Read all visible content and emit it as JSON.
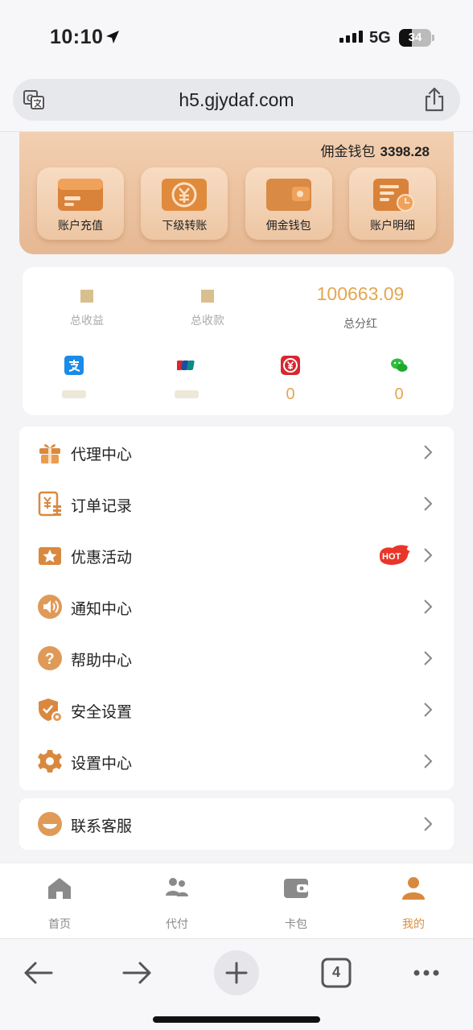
{
  "status_bar": {
    "time": "10:10",
    "network": "5G",
    "battery": "34"
  },
  "browser": {
    "url": "h5.gjydaf.com",
    "tab_count": "4"
  },
  "wallet": {
    "label": "佣金钱包",
    "amount": "3398.28",
    "actions": [
      {
        "label": "账户充值",
        "icon": "card-icon"
      },
      {
        "label": "下级转账",
        "icon": "yuan-exchange-icon"
      },
      {
        "label": "佣金钱包",
        "icon": "wallet-icon"
      },
      {
        "label": "账户明细",
        "icon": "statement-icon"
      }
    ]
  },
  "stats": {
    "total_income_label": "总收益",
    "total_receipts_label": "总收款",
    "total_dividend_label": "总分红",
    "total_dividend_value": "100663.09",
    "channels": [
      {
        "icon": "alipay-icon",
        "value": ""
      },
      {
        "icon": "unionpay-icon",
        "value": ""
      },
      {
        "icon": "digital-yuan-icon",
        "value": "0"
      },
      {
        "icon": "wechat-icon",
        "value": "0"
      }
    ]
  },
  "menu": [
    {
      "label": "代理中心",
      "icon": "gift-icon"
    },
    {
      "label": "订单记录",
      "icon": "order-icon"
    },
    {
      "label": "优惠活动",
      "icon": "star-icon",
      "badge": "HOT"
    },
    {
      "label": "通知中心",
      "icon": "speaker-icon"
    },
    {
      "label": "帮助中心",
      "icon": "question-icon"
    },
    {
      "label": "安全设置",
      "icon": "shield-icon"
    },
    {
      "label": "设置中心",
      "icon": "gear-icon"
    }
  ],
  "contact": {
    "label": "联系客服",
    "icon": "smile-icon"
  },
  "tabbar": {
    "items": [
      {
        "label": "首页",
        "icon": "home-icon"
      },
      {
        "label": "代付",
        "icon": "users-icon"
      },
      {
        "label": "卡包",
        "icon": "wallet-icon"
      },
      {
        "label": "我的",
        "icon": "profile-icon",
        "active": true
      }
    ]
  },
  "colors": {
    "accent": "#d9913b",
    "wallet_bg": "#e9bd98",
    "value_orange": "#e4a650"
  }
}
